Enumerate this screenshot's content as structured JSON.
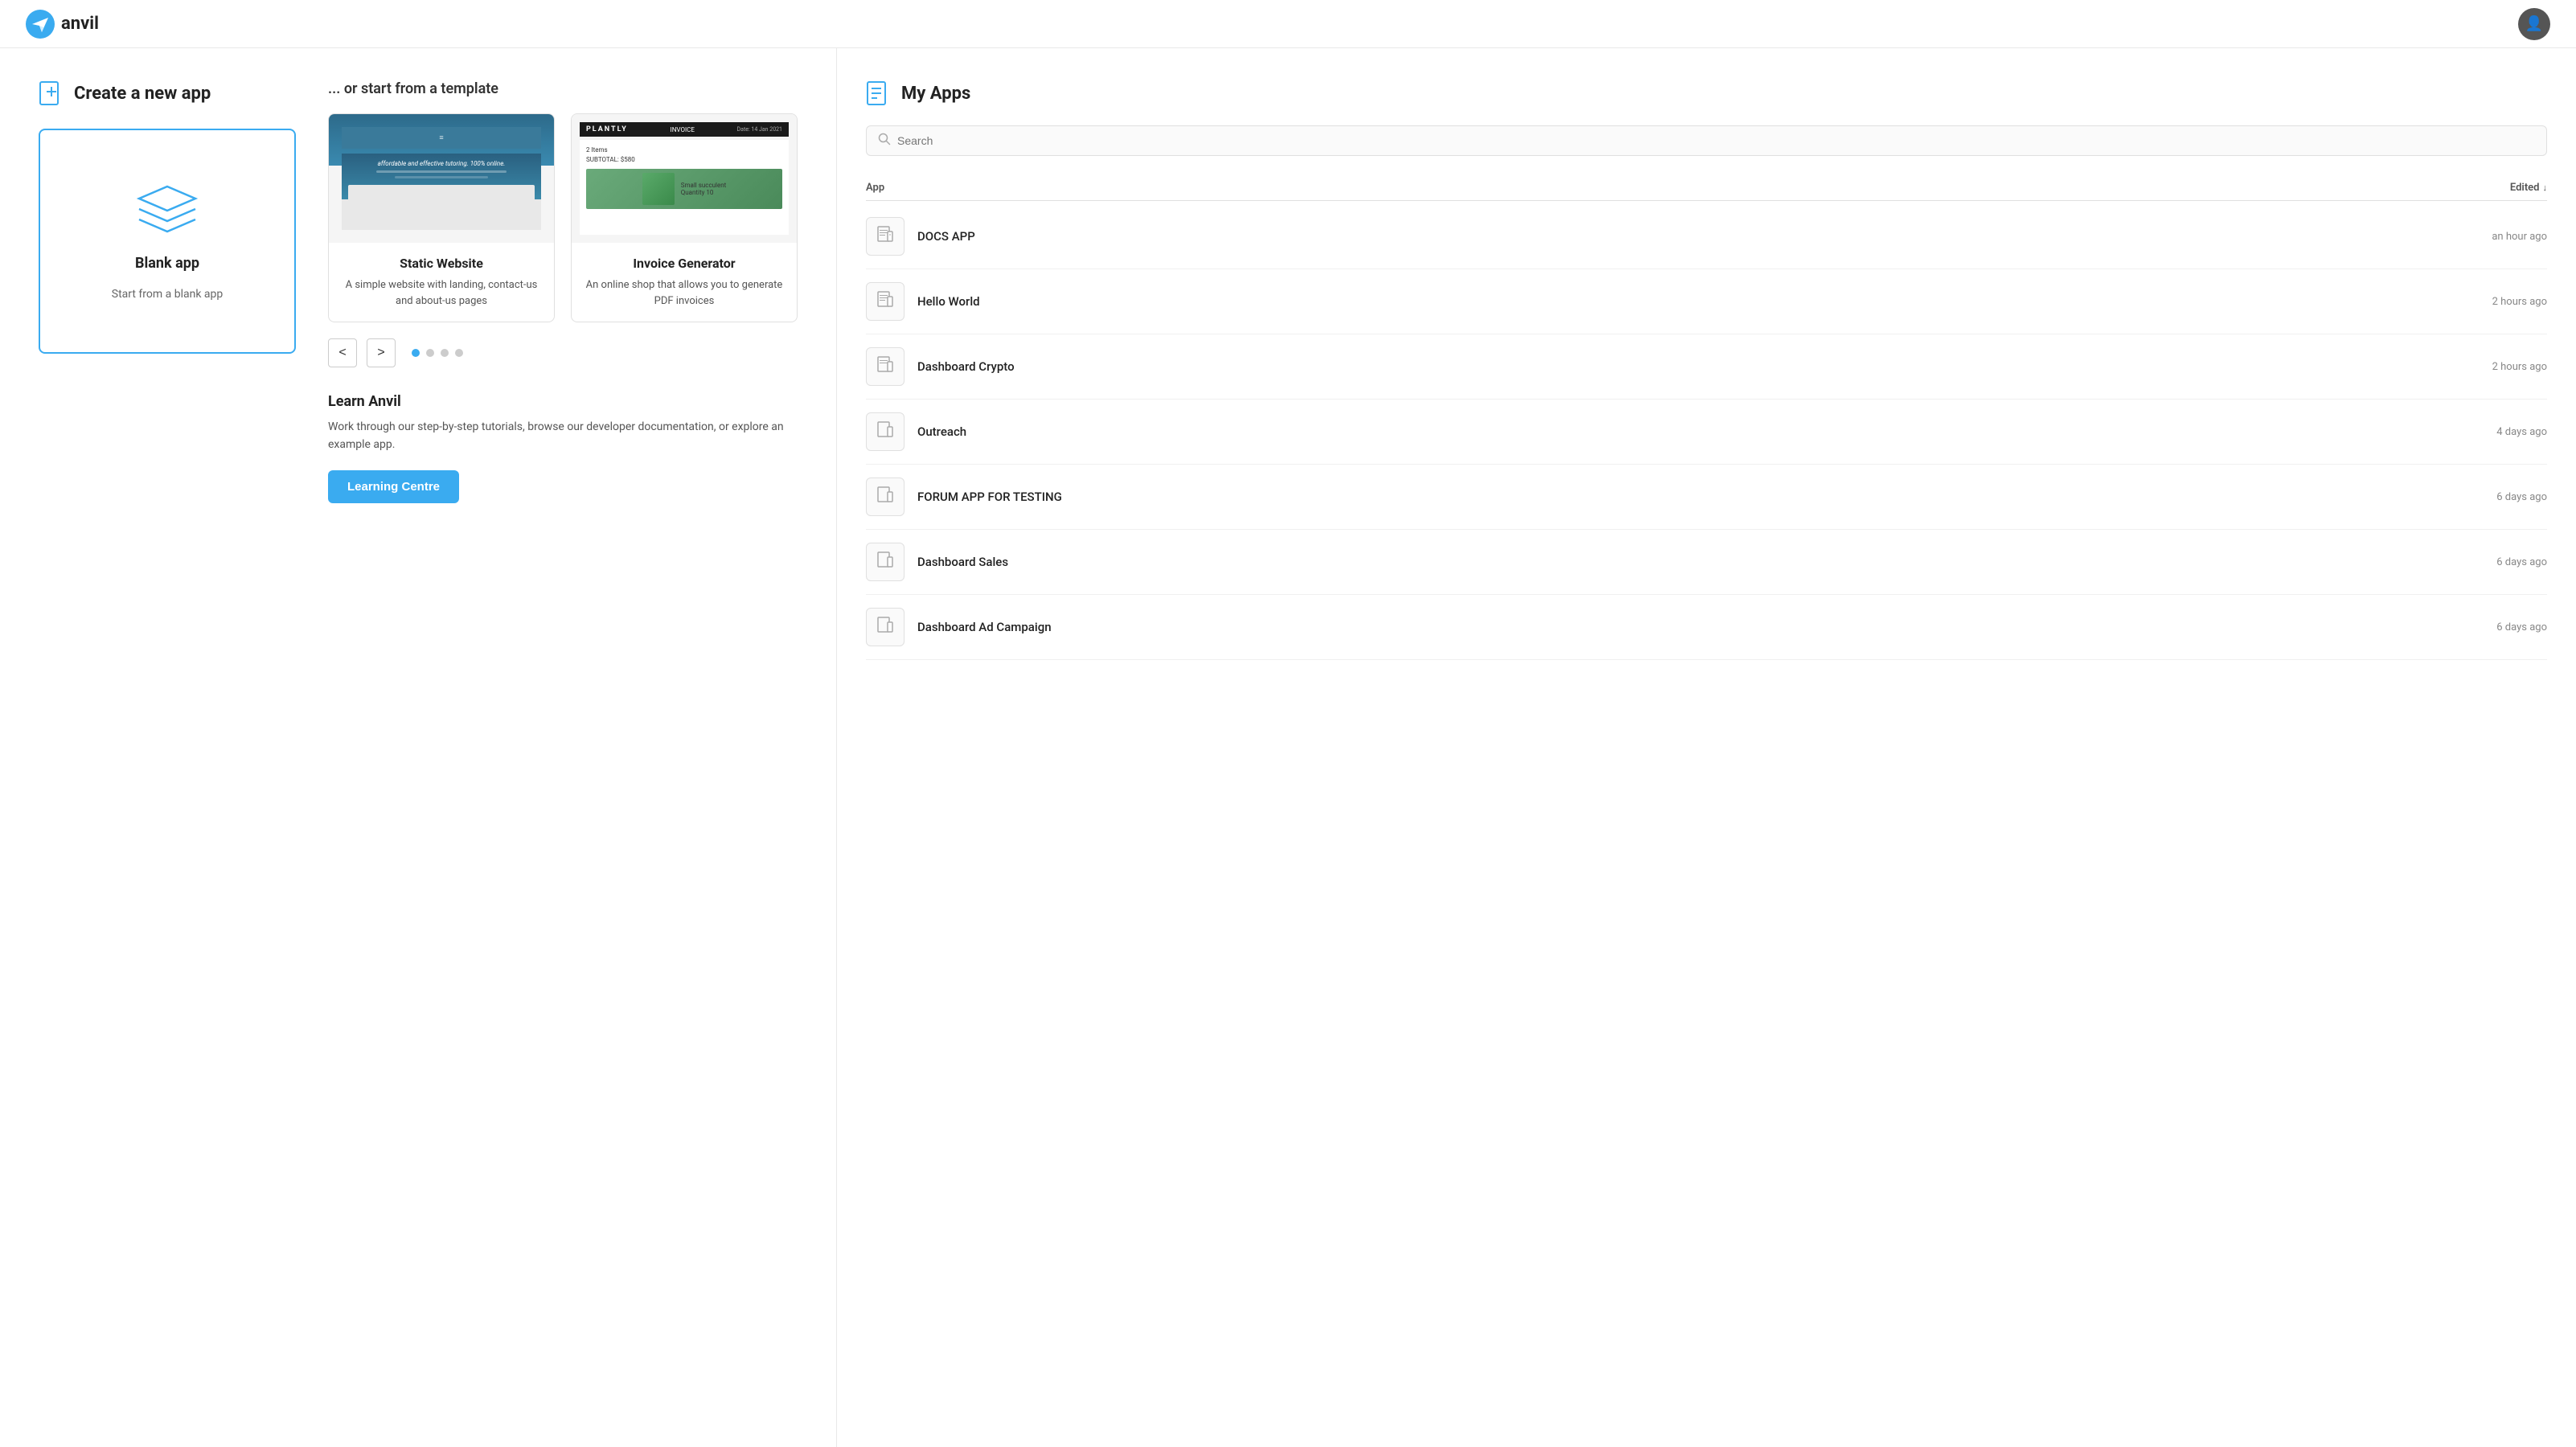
{
  "header": {
    "logo_text": "anvil",
    "avatar_icon": "👤"
  },
  "create_section": {
    "title": "Create a new app",
    "blank_app": {
      "name": "Blank app",
      "description": "Start from a blank app"
    }
  },
  "template_section": {
    "header": "... or start from a template",
    "templates": [
      {
        "name": "Static Website",
        "description": "A simple website with landing, contact-us and about-us pages",
        "type": "static"
      },
      {
        "name": "Invoice Generator",
        "description": "An online shop that allows you to generate PDF invoices",
        "type": "invoice"
      }
    ],
    "dots": [
      {
        "active": true
      },
      {
        "active": false
      },
      {
        "active": false
      },
      {
        "active": false
      }
    ],
    "prev_btn": "<",
    "next_btn": ">"
  },
  "learn_section": {
    "title": "Learn Anvil",
    "description": "Work through our step-by-step tutorials, browse our developer documentation, or explore an example app.",
    "button_label": "Learning Centre"
  },
  "my_apps": {
    "title": "My Apps",
    "search_placeholder": "Search",
    "col_app": "App",
    "col_edited": "Edited",
    "sort_arrow": "↓",
    "apps": [
      {
        "name": "DOCS APP",
        "edited": "an hour ago"
      },
      {
        "name": "Hello World",
        "edited": "2 hours ago"
      },
      {
        "name": "Dashboard Crypto",
        "edited": "2 hours ago"
      },
      {
        "name": "Outreach",
        "edited": "4 days ago"
      },
      {
        "name": "FORUM APP FOR TESTING",
        "edited": "6 days ago"
      },
      {
        "name": "Dashboard Sales",
        "edited": "6 days ago"
      },
      {
        "name": "Dashboard Ad Campaign",
        "edited": "6 days ago"
      }
    ]
  },
  "static_preview": {
    "text": "affordable and effective tutoring. 100% online.",
    "bar1": "",
    "bar2": ""
  },
  "invoice_preview": {
    "logo": "PLANTLY",
    "label": "INVOICE",
    "date": "Date: 14 Jan 2021",
    "items": "2 Items",
    "subtotal": "SUBTOTAL: $580",
    "product": "Small succulent",
    "quantity": "Quantity 10"
  }
}
